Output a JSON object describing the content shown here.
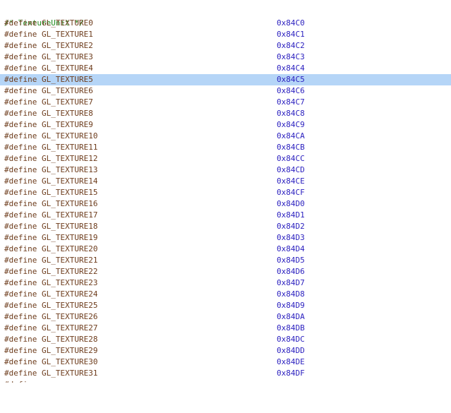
{
  "editor": {
    "comment": "/* TextureUnit */",
    "directive": "#define",
    "lines": [
      {
        "name": "GL_TEXTURE0",
        "value": "0x84C0"
      },
      {
        "name": "GL_TEXTURE1",
        "value": "0x84C1"
      },
      {
        "name": "GL_TEXTURE2",
        "value": "0x84C2"
      },
      {
        "name": "GL_TEXTURE3",
        "value": "0x84C3"
      },
      {
        "name": "GL_TEXTURE4",
        "value": "0x84C4"
      },
      {
        "name": "GL_TEXTURE5",
        "value": "0x84C5"
      },
      {
        "name": "GL_TEXTURE6",
        "value": "0x84C6"
      },
      {
        "name": "GL_TEXTURE7",
        "value": "0x84C7"
      },
      {
        "name": "GL_TEXTURE8",
        "value": "0x84C8"
      },
      {
        "name": "GL_TEXTURE9",
        "value": "0x84C9"
      },
      {
        "name": "GL_TEXTURE10",
        "value": "0x84CA"
      },
      {
        "name": "GL_TEXTURE11",
        "value": "0x84CB"
      },
      {
        "name": "GL_TEXTURE12",
        "value": "0x84CC"
      },
      {
        "name": "GL_TEXTURE13",
        "value": "0x84CD"
      },
      {
        "name": "GL_TEXTURE14",
        "value": "0x84CE"
      },
      {
        "name": "GL_TEXTURE15",
        "value": "0x84CF"
      },
      {
        "name": "GL_TEXTURE16",
        "value": "0x84D0"
      },
      {
        "name": "GL_TEXTURE17",
        "value": "0x84D1"
      },
      {
        "name": "GL_TEXTURE18",
        "value": "0x84D2"
      },
      {
        "name": "GL_TEXTURE19",
        "value": "0x84D3"
      },
      {
        "name": "GL_TEXTURE20",
        "value": "0x84D4"
      },
      {
        "name": "GL_TEXTURE21",
        "value": "0x84D5"
      },
      {
        "name": "GL_TEXTURE22",
        "value": "0x84D6"
      },
      {
        "name": "GL_TEXTURE23",
        "value": "0x84D7"
      },
      {
        "name": "GL_TEXTURE24",
        "value": "0x84D8"
      },
      {
        "name": "GL_TEXTURE25",
        "value": "0x84D9"
      },
      {
        "name": "GL_TEXTURE26",
        "value": "0x84DA"
      },
      {
        "name": "GL_TEXTURE27",
        "value": "0x84DB"
      },
      {
        "name": "GL_TEXTURE28",
        "value": "0x84DC"
      },
      {
        "name": "GL_TEXTURE29",
        "value": "0x84DD"
      },
      {
        "name": "GL_TEXTURE30",
        "value": "0x84DE"
      },
      {
        "name": "GL_TEXTURE31",
        "value": "0x84DF"
      }
    ],
    "highlighted_line": 5,
    "colors": {
      "comment": "#238c1f",
      "directive": "#6d3c1c",
      "value": "#2a1fbf",
      "highlight": "#b5d5f7"
    }
  }
}
